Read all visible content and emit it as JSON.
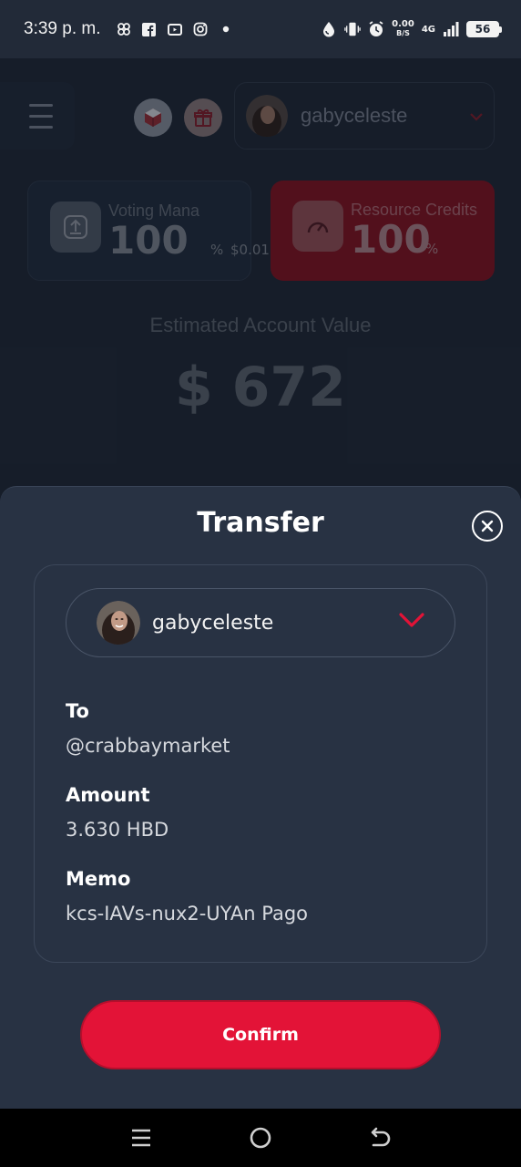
{
  "status_bar": {
    "time": "3:39 p. m.",
    "net_speed_value": "0.00",
    "net_speed_unit": "B/S",
    "network_type": "4G",
    "battery": "56",
    "icons": [
      "pinwheel-icon",
      "facebook-icon",
      "youtube-icon",
      "instagram-icon",
      "dot-icon",
      "water-drop-icon",
      "vibrate-icon",
      "alarm-icon",
      "signal-icon",
      "battery-icon"
    ]
  },
  "header": {
    "account_name": "gabyceleste"
  },
  "stats": {
    "voting_mana": {
      "label": "Voting Mana",
      "value": "100",
      "unit": "%",
      "extra": "$0.01"
    },
    "resource_credits": {
      "label": "Resource Credits",
      "value": "100",
      "unit": "%"
    }
  },
  "account_value": {
    "title": "Estimated Account Value",
    "value": "$ 672"
  },
  "transfer": {
    "title": "Transfer",
    "from_account": "gabyceleste",
    "to_label": "To",
    "to_value": "@crabbaymarket",
    "amount_label": "Amount",
    "amount_value": "3.630 HBD",
    "memo_label": "Memo",
    "memo_value": "kcs-IAVs-nux2-UYAn Pago",
    "confirm_label": "Confirm"
  },
  "colors": {
    "accent": "#e31337",
    "sheet_bg": "#283243",
    "app_bg": "#1e2634"
  }
}
